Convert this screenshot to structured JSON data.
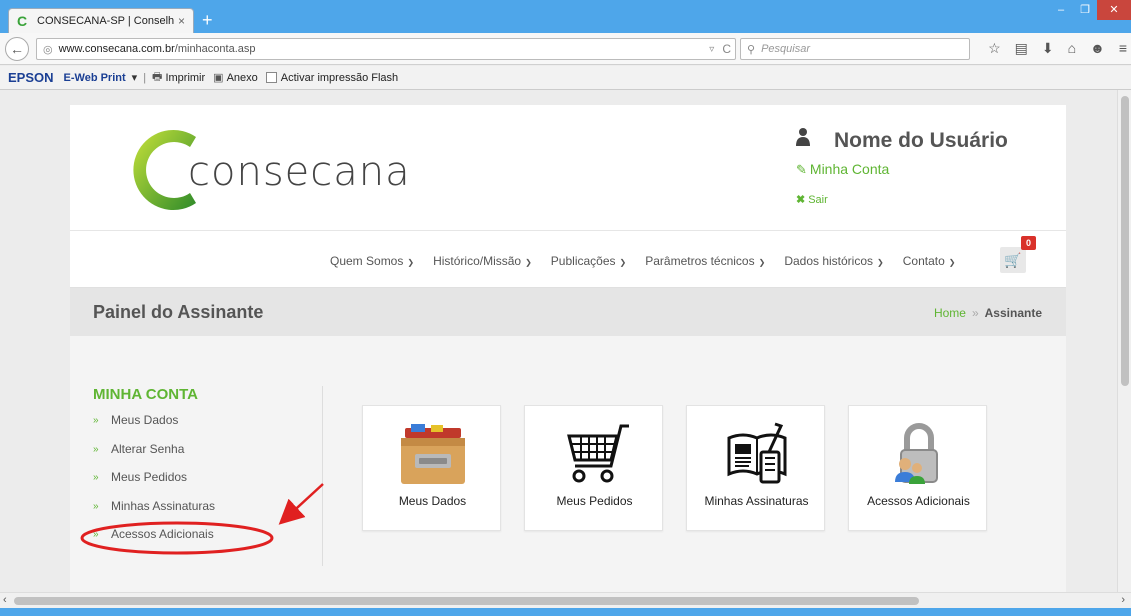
{
  "browser": {
    "tab_title": "CONSECANA-SP | Conselh...",
    "tab_close": "×",
    "new_tab": "+",
    "url_domain": "www.consecana.com.br",
    "url_path": "/minhaconta.asp",
    "search_placeholder": "Pesquisar"
  },
  "epson": {
    "logo": "EPSON",
    "product": "E-Web Print",
    "print": "Imprimir",
    "attach": "Anexo",
    "flash": "Activar impressão Flash"
  },
  "header": {
    "logo_text": "consecana",
    "user_name": "Nome do Usuário",
    "account_link": "Minha Conta",
    "logout_link": "Sair"
  },
  "menu": {
    "items": [
      "Quem Somos",
      "Histórico/Missão",
      "Publicações",
      "Parâmetros técnicos",
      "Dados históricos",
      "Contato"
    ],
    "cart_count": "0"
  },
  "page": {
    "title": "Painel do Assinante",
    "breadcrumb_home": "Home",
    "breadcrumb_sep": "»",
    "breadcrumb_current": "Assinante"
  },
  "sidebar": {
    "title": "MINHA CONTA",
    "items": [
      "Meus Dados",
      "Alterar Senha",
      "Meus Pedidos",
      "Minhas Assinaturas",
      "Acessos Adicionais"
    ]
  },
  "tiles": [
    {
      "label": "Meus Dados",
      "icon": "drawer-icon"
    },
    {
      "label": "Meus Pedidos",
      "icon": "cart-icon"
    },
    {
      "label": "Minhas Assinaturas",
      "icon": "newspaper-icon"
    },
    {
      "label": "Acessos Adicionais",
      "icon": "padlock-users-icon"
    }
  ],
  "colors": {
    "brand_green": "#5fb533",
    "chrome_blue": "#4ea6ea",
    "annotation_red": "#e02020"
  }
}
